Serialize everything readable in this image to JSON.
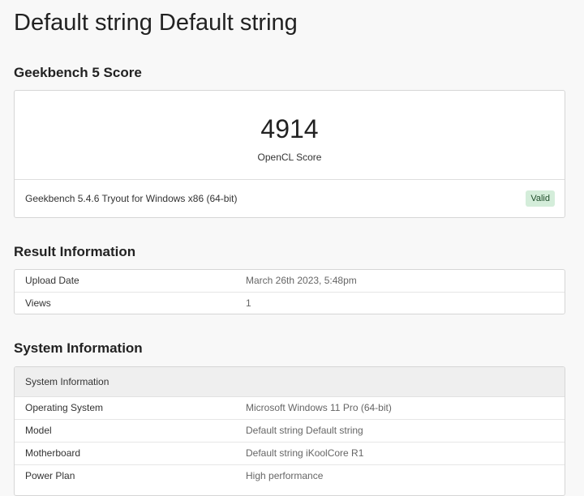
{
  "page": {
    "title": "Default string Default string"
  },
  "score_section": {
    "title": "Geekbench 5 Score",
    "score": "4914",
    "score_label": "OpenCL Score",
    "version": "Geekbench 5.4.6 Tryout for Windows x86 (64-bit)",
    "status": "Valid"
  },
  "result_section": {
    "title": "Result Information",
    "rows": [
      {
        "key": "Upload Date",
        "value": "March 26th 2023, 5:48pm"
      },
      {
        "key": "Views",
        "value": "1"
      }
    ]
  },
  "system_section": {
    "title": "System Information",
    "table_header": "System Information",
    "rows": [
      {
        "key": "Operating System",
        "value": "Microsoft Windows 11 Pro (64-bit)"
      },
      {
        "key": "Model",
        "value": "Default string Default string"
      },
      {
        "key": "Motherboard",
        "value": "Default string iKoolCore R1"
      },
      {
        "key": "Power Plan",
        "value": "High performance"
      }
    ]
  },
  "colors": {
    "valid_badge_bg": "#d4edda",
    "valid_badge_text": "#1f4d2a",
    "table_header_bg": "#efefef"
  }
}
